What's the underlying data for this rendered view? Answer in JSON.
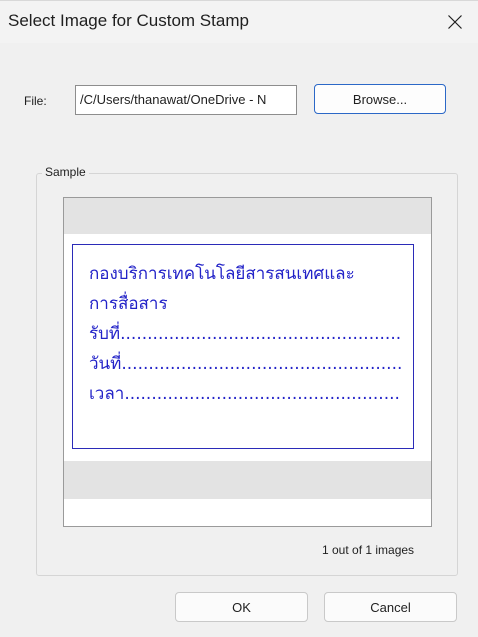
{
  "dialog": {
    "title": "Select Image for Custom Stamp",
    "close_icon": "close-icon"
  },
  "file": {
    "label": "File:",
    "value": "/C/Users/thanawat/OneDrive - N",
    "browse_label": "Browse..."
  },
  "sample": {
    "group_label": "Sample",
    "stamp_lines": [
      "กองบริการเทคโนโลยีสารสนเทศและ",
      "การสื่อสาร",
      "รับที่.............................................................",
      "วันที่..............................................................",
      "เวลา..............................................................."
    ],
    "stamp_color": "#2323c8",
    "counter": "1 out of 1 images"
  },
  "buttons": {
    "ok_label": "OK",
    "cancel_label": "Cancel"
  }
}
